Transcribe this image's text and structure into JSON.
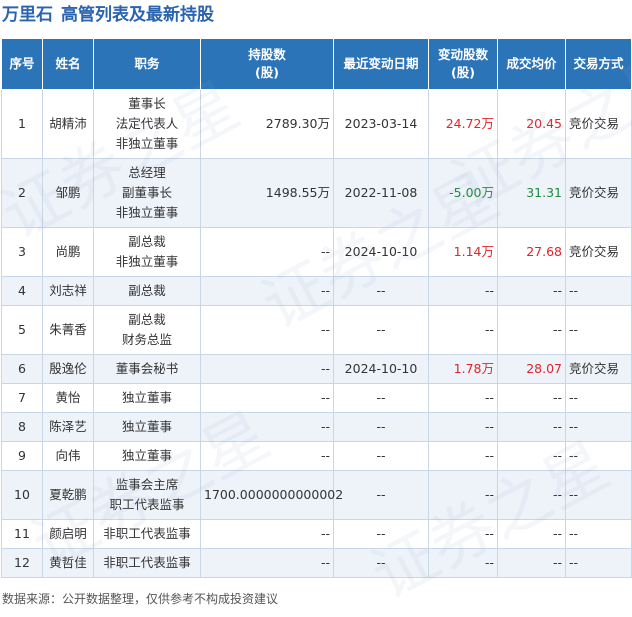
{
  "header": {
    "company": "万里石",
    "title": "高管列表及最新持股"
  },
  "table": {
    "columns": [
      [
        "序号"
      ],
      [
        "姓名"
      ],
      [
        "职务"
      ],
      [
        "持股数",
        "(股)"
      ],
      [
        "最近变动日期"
      ],
      [
        "变动股数",
        "(股)"
      ],
      [
        "成交均价"
      ],
      [
        "交易方式"
      ]
    ],
    "rows": [
      {
        "seq": "1",
        "name": "胡精沛",
        "roles": [
          "董事长",
          "法定代表人",
          "非独立董事"
        ],
        "shares": "2789.30万",
        "date": "2023-03-14",
        "change": "24.72万",
        "change_dir": "up",
        "price": "20.45",
        "price_dir": "up",
        "method": "竞价交易"
      },
      {
        "seq": "2",
        "name": "邹鹏",
        "roles": [
          "总经理",
          "副董事长",
          "非独立董事"
        ],
        "shares": "1498.55万",
        "date": "2022-11-08",
        "change": "-5.00万",
        "change_dir": "down",
        "price": "31.31",
        "price_dir": "down",
        "method": "竞价交易"
      },
      {
        "seq": "3",
        "name": "尚鹏",
        "roles": [
          "副总裁",
          "非独立董事"
        ],
        "shares": "--",
        "date": "2024-10-10",
        "change": "1.14万",
        "change_dir": "up",
        "price": "27.68",
        "price_dir": "up",
        "method": "竞价交易"
      },
      {
        "seq": "4",
        "name": "刘志祥",
        "roles": [
          "副总裁"
        ],
        "shares": "--",
        "date": "--",
        "change": "--",
        "change_dir": "none",
        "price": "--",
        "price_dir": "none",
        "method": "--"
      },
      {
        "seq": "5",
        "name": "朱菁香",
        "roles": [
          "副总裁",
          "财务总监"
        ],
        "shares": "--",
        "date": "--",
        "change": "--",
        "change_dir": "none",
        "price": "--",
        "price_dir": "none",
        "method": "--"
      },
      {
        "seq": "6",
        "name": "殷逸伦",
        "roles": [
          "董事会秘书"
        ],
        "shares": "--",
        "date": "2024-10-10",
        "change": "1.78万",
        "change_dir": "up",
        "price": "28.07",
        "price_dir": "up",
        "method": "竞价交易"
      },
      {
        "seq": "7",
        "name": "黄怡",
        "roles": [
          "独立董事"
        ],
        "shares": "--",
        "date": "--",
        "change": "--",
        "change_dir": "none",
        "price": "--",
        "price_dir": "none",
        "method": "--"
      },
      {
        "seq": "8",
        "name": "陈泽艺",
        "roles": [
          "独立董事"
        ],
        "shares": "--",
        "date": "--",
        "change": "--",
        "change_dir": "none",
        "price": "--",
        "price_dir": "none",
        "method": "--"
      },
      {
        "seq": "9",
        "name": "向伟",
        "roles": [
          "独立董事"
        ],
        "shares": "--",
        "date": "--",
        "change": "--",
        "change_dir": "none",
        "price": "--",
        "price_dir": "none",
        "method": "--"
      },
      {
        "seq": "10",
        "name": "夏乾鹏",
        "roles": [
          "监事会主席",
          "职工代表监事"
        ],
        "shares": "1700.0000000000002",
        "date": "--",
        "change": "--",
        "change_dir": "none",
        "price": "--",
        "price_dir": "none",
        "method": "--"
      },
      {
        "seq": "11",
        "name": "颜启明",
        "roles": [
          "非职工代表监事"
        ],
        "shares": "--",
        "date": "--",
        "change": "--",
        "change_dir": "none",
        "price": "--",
        "price_dir": "none",
        "method": "--"
      },
      {
        "seq": "12",
        "name": "黄哲佳",
        "roles": [
          "非职工代表监事"
        ],
        "shares": "--",
        "date": "--",
        "change": "--",
        "change_dir": "none",
        "price": "--",
        "price_dir": "none",
        "method": "--"
      }
    ]
  },
  "footer": {
    "source": "数据来源：公开数据整理，仅供参考不构成投资建议"
  },
  "watermark": {
    "text": "证券之星"
  },
  "colors": {
    "header_bg": "#2b74b8",
    "title": "#2a64b0",
    "up": "#e0242b",
    "down": "#1f8a3b"
  }
}
